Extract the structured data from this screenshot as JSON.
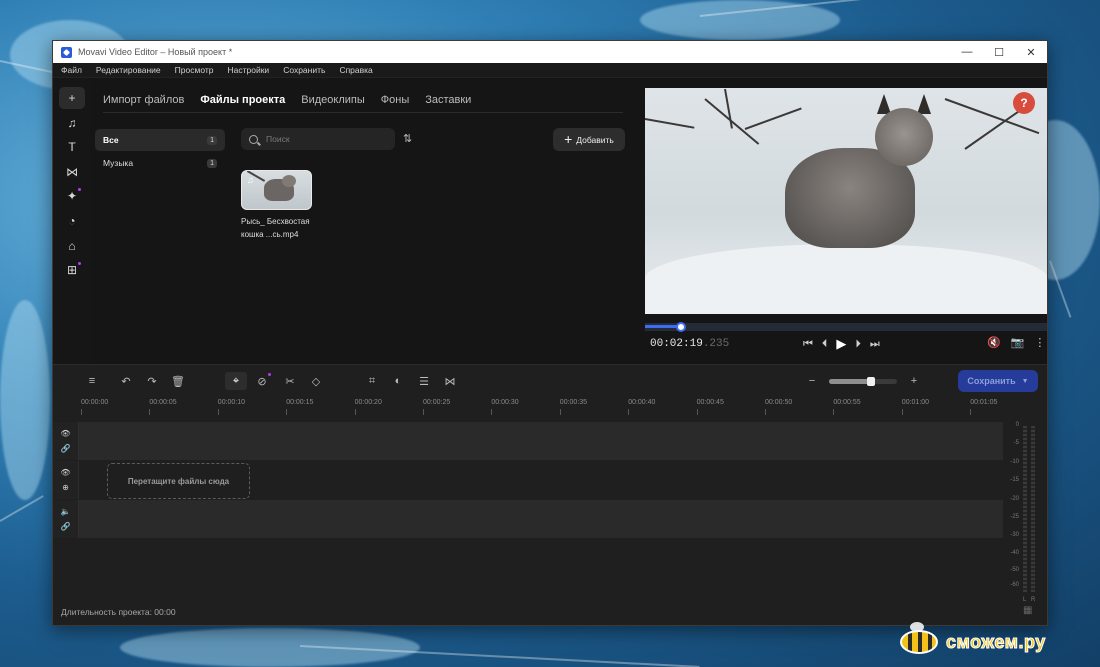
{
  "window": {
    "title": "Movavi Video Editor – Новый проект *",
    "controls": [
      "—",
      "☐",
      "✕"
    ]
  },
  "menu": [
    "Файл",
    "Редактирование",
    "Просмотр",
    "Настройки",
    "Сохранить",
    "Справка"
  ],
  "tools": [
    {
      "name": "import-tool",
      "icon": "+",
      "active": true
    },
    {
      "name": "music-tool",
      "icon": "♫"
    },
    {
      "name": "titles-tool",
      "icon": "T"
    },
    {
      "name": "transitions-tool",
      "icon": "⋈"
    },
    {
      "name": "effects-tool",
      "icon": "✦",
      "badge": true
    },
    {
      "name": "stickers-tool",
      "icon": "◔"
    },
    {
      "name": "more-tools",
      "icon": "⌂"
    },
    {
      "name": "apps-tool",
      "icon": "⊞",
      "badge": true
    }
  ],
  "tabs": [
    "Импорт файлов",
    "Файлы проекта",
    "Видеоклипы",
    "Фоны",
    "Заставки"
  ],
  "active_tab": 1,
  "categories": [
    {
      "label": "Все",
      "count": "1",
      "active": true
    },
    {
      "label": "Музыка",
      "count": "1",
      "active": false
    }
  ],
  "search": {
    "placeholder": "Поиск"
  },
  "add_button": "Добавить",
  "media": [
    {
      "name_line1": "Рысь_ Бесхвостая",
      "name_line2": "кошка ...сь.mp4"
    }
  ],
  "player": {
    "timecode_main": "00:02:19",
    "timecode_ms": ".235",
    "progress": 0.09,
    "help": "?"
  },
  "timeline": {
    "save_button": "Сохранить",
    "zoom": 0.62,
    "ruler": [
      "00:00:00",
      "00:00:05",
      "00:00:10",
      "00:00:15",
      "00:00:20",
      "00:00:25",
      "00:00:30",
      "00:00:35",
      "00:00:40",
      "00:00:45",
      "00:00:50",
      "00:00:55",
      "00:01:00",
      "00:01:05"
    ],
    "drop_text": "Перетащите файлы сюда",
    "duration": "Длительность проекта: 00:00",
    "meter_labels": [
      "0",
      "-5",
      "-10",
      "-15",
      "-20",
      "-25",
      "-30",
      "-40",
      "-50",
      "-60"
    ],
    "meter_channels": [
      "L",
      "R"
    ]
  },
  "watermark": "сможем.ру"
}
